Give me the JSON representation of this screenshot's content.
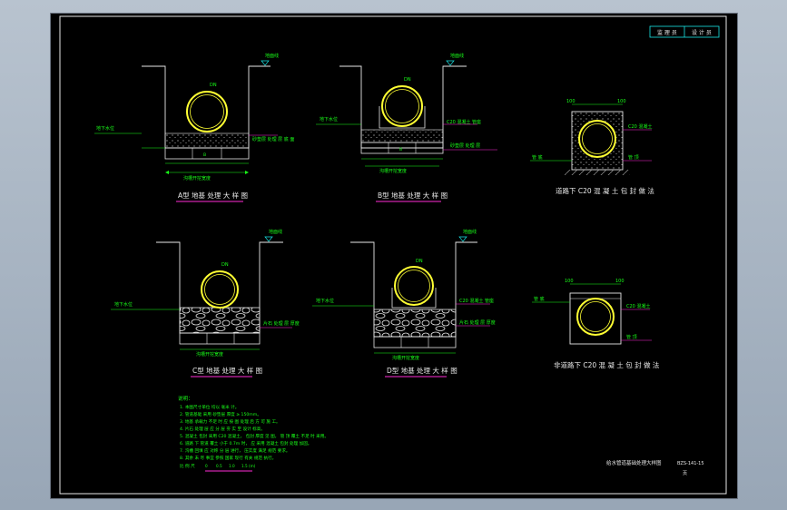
{
  "title_block": {
    "cell_left": "监 理 员",
    "cell_right": "设 计 员",
    "sheet_title": "给水管道基础处理大样图",
    "drawing_no": "BZS-141-15",
    "sheet_label": "页"
  },
  "details": {
    "a": {
      "title": "A型 地基 处理 大 样 图",
      "ground_label": "地面线",
      "water_label": "地下水位",
      "pipe_dn": "DN",
      "bed_label": "砂垫层 处理 层 底 面",
      "width_label": "沟槽开挖宽度",
      "width_mark": "B"
    },
    "b": {
      "title": "B型 地基 处理 大 样 图",
      "ground_label": "地面线",
      "water_label": "地下水位",
      "pipe_dn": "DN",
      "cradle_label": "C20 混凝土 管座",
      "bed_label": "砂垫层 处理 层",
      "width_label": "沟槽开挖宽度",
      "width_mark": "B"
    },
    "c": {
      "title": "C型 地基 处理 大 样 图",
      "ground_label": "地面线",
      "water_label": "地下水位",
      "pipe_dn": "DN",
      "bed_label": "片石 处理 层 厚度",
      "width_label": "沟槽开挖宽度"
    },
    "d": {
      "title": "D型 地基 处理 大 样 图",
      "ground_label": "地面线",
      "water_label": "地下水位",
      "pipe_dn": "DN",
      "cradle_label": "C20 混凝土 管座",
      "bed_label": "片石 处理 层 厚度",
      "width_label": "沟槽开挖宽度"
    },
    "e": {
      "title": "道路下 C20 混 凝 土 包 封 做 法",
      "dim_left": "100",
      "dim_right": "100",
      "label_top": "C20 混凝土",
      "label_mid": "管 顶",
      "label_bot": "管 底"
    },
    "f": {
      "title": "非道路下 C20 混 凝 土 包 封 做 法",
      "dim_left": "100",
      "dim_right": "100",
      "label_top": "C20 混凝土",
      "label_mid": "管 顶",
      "label_bot": "管 底"
    }
  },
  "notes": {
    "heading": "说明：",
    "lines": [
      "1. 本图尺寸单位 均以 毫米 计。",
      "2. 管道基础 采用 砂垫层 厚度 ≥ 150mm。",
      "3. 地基 承载力 不足 时 应 按 图 处理 后 方 可 施 工。",
      "4. 片石 处理 层 应 分 层 夯 实 至 设计 标高。",
      "5. 混凝土 包封 采用 C20 混凝土， 包封 厚度 见 图， 管 顶 覆土 不足 时 采用。",
      "6. 道路 下 管道 覆土 小于 0.7m 时， 应 采用 混凝土 包封 处理 加固。",
      "7. 沟槽 回填 应 对称 分 层 进行， 压实度 满足 规范 要求。",
      "8. 其余 未 尽 事宜 参照 国家 现行 有关 规范 执行。"
    ],
    "scale_label": "比 例 尺",
    "scale_ticks": [
      "0",
      "0.5",
      "1.0",
      "1.5 (m)"
    ]
  },
  "colors": {
    "white": "#e8e8e8",
    "green": "#19ff19",
    "yellow": "#ffff33",
    "magenta": "#ff2bd6",
    "cyan": "#19e6e6",
    "gray": "#9a9a9a"
  }
}
